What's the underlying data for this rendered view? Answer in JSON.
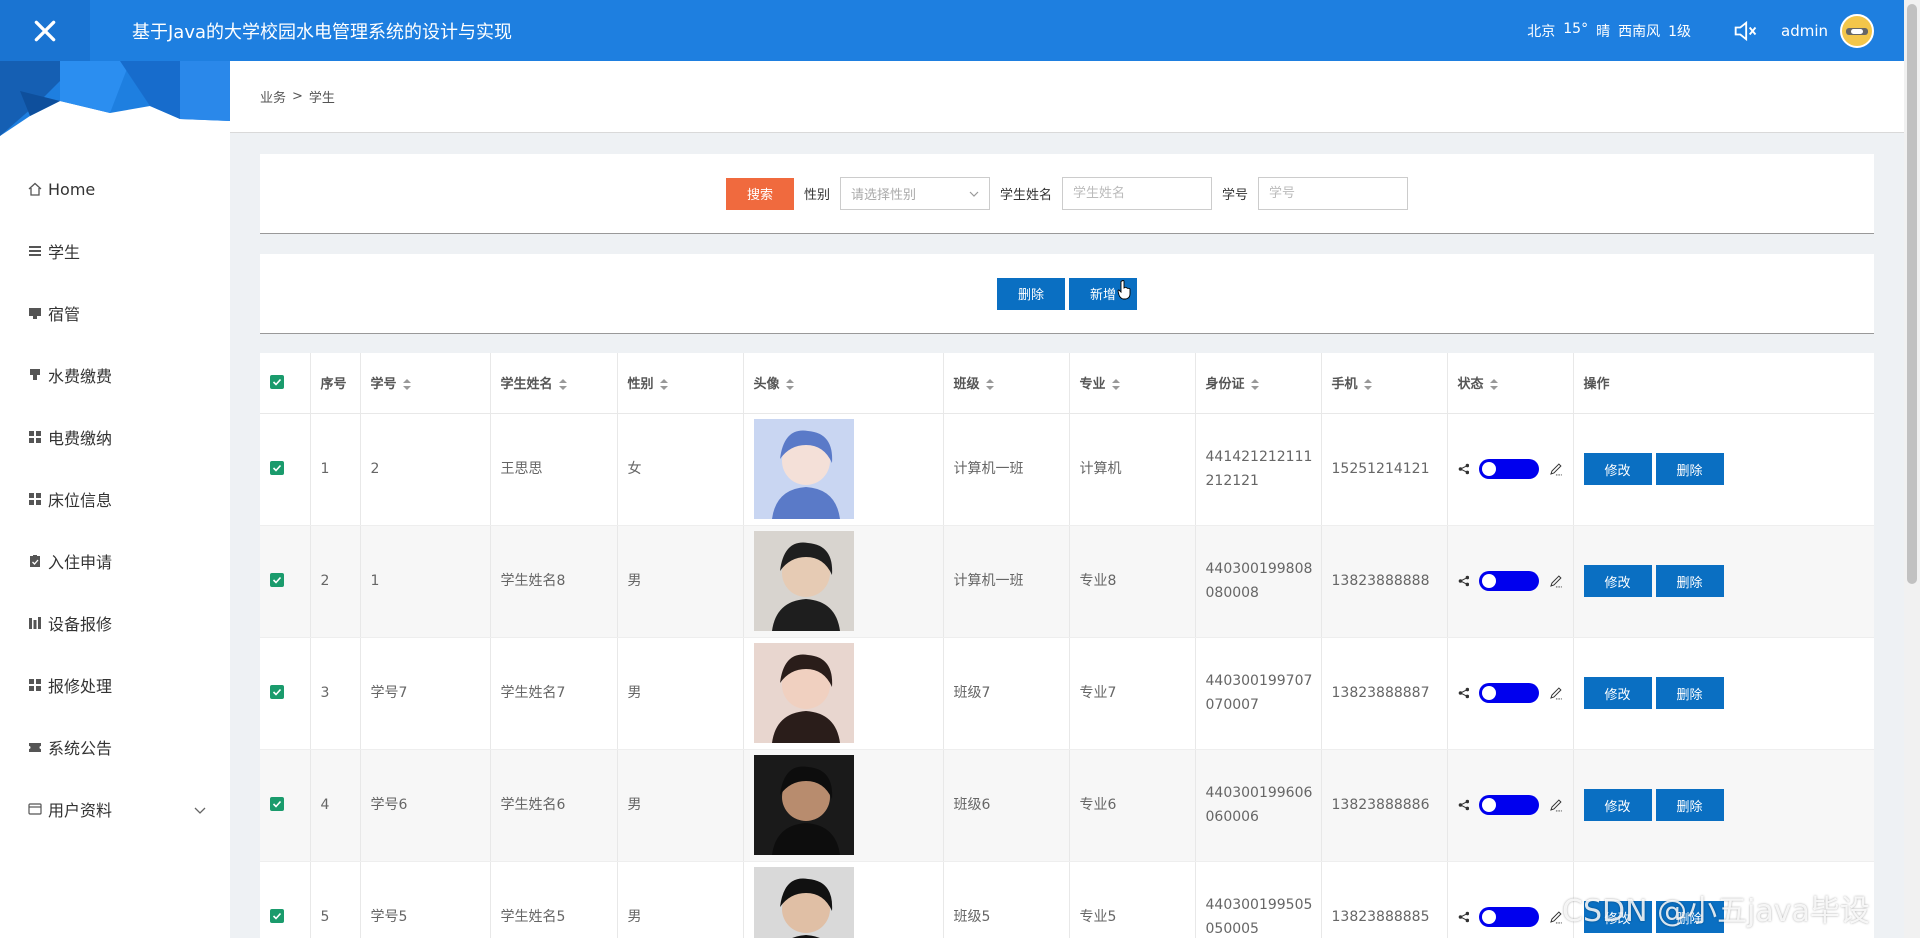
{
  "header": {
    "title": "基于Java的大学校园水电管理系统的设计与实现",
    "weather": [
      "北京",
      "15°",
      "晴",
      "西南风",
      "1级"
    ],
    "username": "admin"
  },
  "sidebar": {
    "items": [
      {
        "label": "Home",
        "icon": "home-icon"
      },
      {
        "label": "学生",
        "icon": "list-icon"
      },
      {
        "label": "宿管",
        "icon": "monitor-icon"
      },
      {
        "label": "水费缴费",
        "icon": "tap-icon"
      },
      {
        "label": "电费缴纳",
        "icon": "grid-icon"
      },
      {
        "label": "床位信息",
        "icon": "grid-icon"
      },
      {
        "label": "入住申请",
        "icon": "clipboard-icon"
      },
      {
        "label": "设备报修",
        "icon": "chart-icon"
      },
      {
        "label": "报修处理",
        "icon": "grid-icon"
      },
      {
        "label": "系统公告",
        "icon": "ticket-icon"
      },
      {
        "label": "用户资料",
        "icon": "card-icon"
      }
    ]
  },
  "breadcrumb": {
    "parent": "业务",
    "separator": ">",
    "current": "学生"
  },
  "search": {
    "button": "搜索",
    "gender_label": "性别",
    "gender_placeholder": "请选择性别",
    "name_label": "学生姓名",
    "name_placeholder": "学生姓名",
    "id_label": "学号",
    "id_placeholder": "学号"
  },
  "actions": {
    "delete": "删除",
    "add": "新增"
  },
  "table": {
    "headers": [
      "序号",
      "学号",
      "学生姓名",
      "性别",
      "头像",
      "班级",
      "专业",
      "身份证",
      "手机",
      "状态",
      "操作"
    ],
    "edit_label": "修改",
    "delete_label": "删除",
    "rows": [
      {
        "no": "1",
        "sid": "2",
        "name": "王思思",
        "gender": "女",
        "class": "计算机一班",
        "major": "计算机",
        "idcard1": "441421212111",
        "idcard2": "212121",
        "phone": "15251214121"
      },
      {
        "no": "2",
        "sid": "1",
        "name": "学生姓名8",
        "gender": "男",
        "class": "计算机一班",
        "major": "专业8",
        "idcard1": "440300199808",
        "idcard2": "080008",
        "phone": "13823888888"
      },
      {
        "no": "3",
        "sid": "学号7",
        "name": "学生姓名7",
        "gender": "男",
        "class": "班级7",
        "major": "专业7",
        "idcard1": "440300199707",
        "idcard2": "070007",
        "phone": "13823888887"
      },
      {
        "no": "4",
        "sid": "学号6",
        "name": "学生姓名6",
        "gender": "男",
        "class": "班级6",
        "major": "专业6",
        "idcard1": "440300199606",
        "idcard2": "060006",
        "phone": "13823888886"
      },
      {
        "no": "5",
        "sid": "学号5",
        "name": "学生姓名5",
        "gender": "男",
        "class": "班级5",
        "major": "专业5",
        "idcard1": "440300199505",
        "idcard2": "050005",
        "phone": "13823888885"
      }
    ]
  },
  "watermark": "CSDN @小五java毕设",
  "colors": {
    "topbar": "#1e7fe0",
    "primary_button": "#0a6fc2",
    "search_button": "#f06a3e",
    "checkbox": "#1a9b6c",
    "toggle": "#0000ee"
  }
}
